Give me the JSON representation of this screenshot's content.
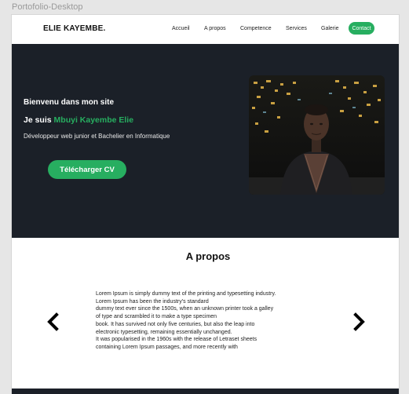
{
  "canvas": {
    "frame_label": "Portofolio-Desktop"
  },
  "nav": {
    "logo": "ELIE KAYEMBE.",
    "links": [
      "Accueil",
      "A propos",
      "Competence",
      "Services",
      "Galerie"
    ],
    "contact": "Contact"
  },
  "hero": {
    "greeting": "Bienvenu dans  mon site",
    "intro_prefix": "Je suis ",
    "name": "Mbuyi Kayembe Elie",
    "role": "Développeur web junior et Bachelier en Informatique",
    "cv_button": "Télécharger CV"
  },
  "about": {
    "title": "A propos",
    "lines": [
      "Lorem Ipsum is simply dummy text of the printing and typesetting industry.",
      "Lorem Ipsum has been the industry's standard",
      "dummy text ever since the 1500s, when an unknown printer took a galley",
      "of type and scrambled it to make a type specimen",
      "book. It has survived not only five centuries, but also the leap into",
      "electronic typesetting, remaining essentially unchanged.",
      "It was popularised in the 1960s with the release of Letraset sheets",
      "containing Lorem Ipsum passages, and more recently with"
    ]
  },
  "colors": {
    "accent": "#27ae60",
    "dark": "#1b2028"
  },
  "icons": {
    "prev": "chevron-left-icon",
    "next": "chevron-right-icon"
  }
}
